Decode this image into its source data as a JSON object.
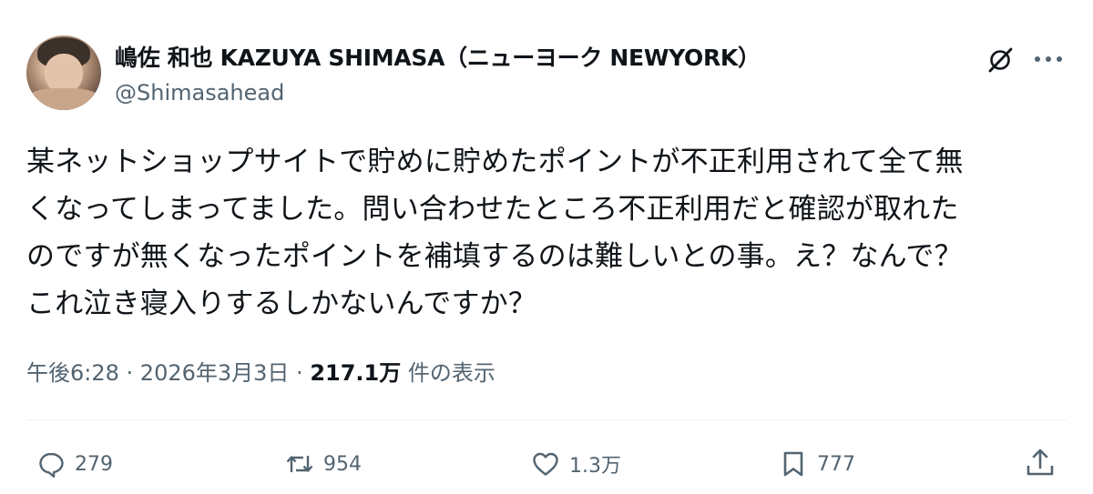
{
  "author": {
    "display_name": "嶋佐 和也 KAZUYA SHIMASA（ニューヨーク NEWYORK）",
    "handle": "@Shimasahead"
  },
  "tweet": {
    "lines": [
      "某ネットショップサイトで貯めに貯めたポイントが不正利用されて全て無",
      "くなってしまってました。問い合わせたところ不正利用だと確認が取れた",
      "のですが無くなったポイントを補填するのは難しいとの事。え？なんで？",
      "これ泣き寝入りするしかないんですか？"
    ]
  },
  "meta": {
    "time": "午後6:28",
    "sep1": " · ",
    "date": "2026年3月3日",
    "sep2": " · ",
    "views": "217.1万",
    "views_suffix": " 件の表示"
  },
  "actions": {
    "replies": "279",
    "reposts": "954",
    "likes": "1.3万",
    "bookmarks": "777"
  },
  "icons": {
    "grok": "grok-icon",
    "more": "more-icon",
    "reply": "reply-icon",
    "repost": "repost-icon",
    "like": "heart-icon",
    "bookmark": "bookmark-icon",
    "share": "share-icon"
  },
  "colors": {
    "text": "#0f1419",
    "secondary": "#536471",
    "divider": "#eff3f4"
  }
}
